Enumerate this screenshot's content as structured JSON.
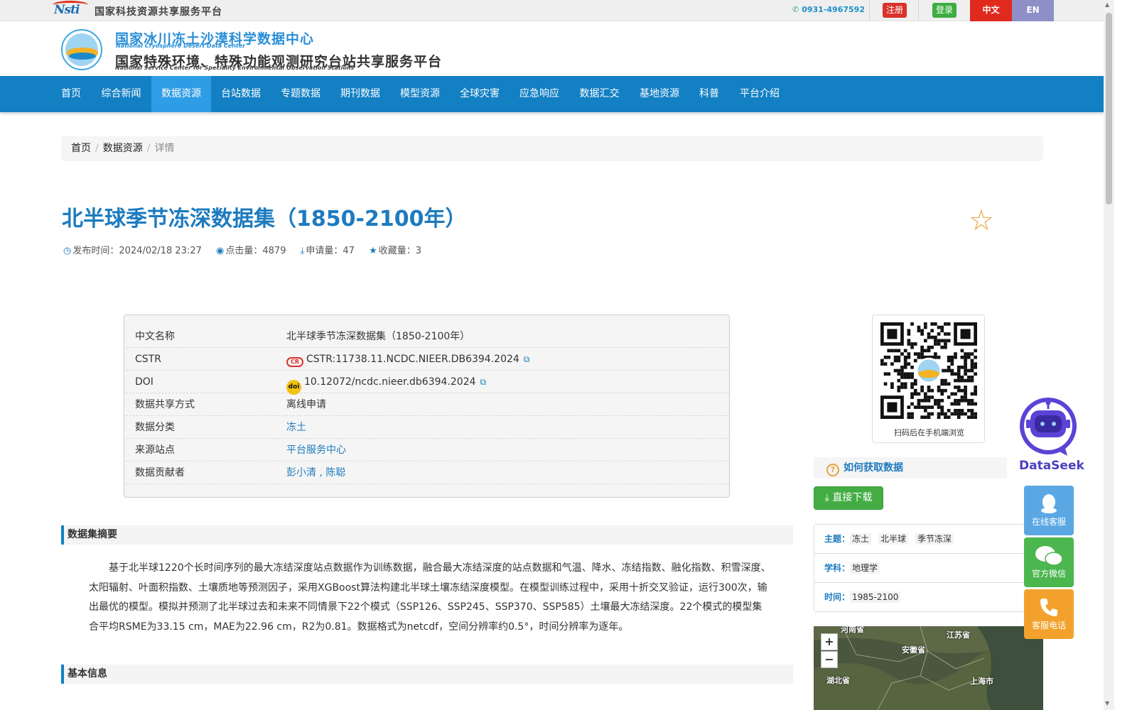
{
  "topbar": {
    "nsti_logo": "Nsti",
    "platform_name": "国家科技资源共享服务平台",
    "phone": "0931-4967592",
    "register_label": "注册",
    "login_label": "登录",
    "lang_zh": "中文",
    "lang_en": "EN"
  },
  "header": {
    "title_cn": "国家冰川冻土沙漠科学数据中心",
    "title_en": "National Cryosphere Desert Data Center",
    "subtitle_cn": "国家特殊环境、特殊功能观测研究台站共享服务平台",
    "subtitle_en": "National Service Center for Speciality Environmental Observation Stations"
  },
  "nav": {
    "items": [
      "首页",
      "综合新闻",
      "数据资源",
      "台站数据",
      "专题数据",
      "期刊数据",
      "模型资源",
      "全球灾害",
      "应急响应",
      "数据汇交",
      "基地资源",
      "科普",
      "平台介绍"
    ],
    "active": "数据资源"
  },
  "breadcrumb": [
    "首页",
    "数据资源",
    "详情"
  ],
  "dataset": {
    "title": "北半球季节冻深数据集（1850-2100年）",
    "publish_label": "发布时间：",
    "publish_time": "2024/02/18 23:27",
    "clicks_label": "点击量：",
    "clicks": "4879",
    "requests_label": "申请量：",
    "requests": "47",
    "favorites_label": "收藏量：",
    "favorites": "3"
  },
  "info": [
    {
      "key": "中文名称",
      "value": "北半球季节冻深数据集（1850-2100年）"
    },
    {
      "key": "CSTR",
      "value": "CSTR:11738.11.NCDC.NIEER.DB6394.2024"
    },
    {
      "key": "DOI",
      "value": "10.12072/ncdc.nieer.db6394.2024"
    },
    {
      "key": "数据共享方式",
      "value": "离线申请"
    },
    {
      "key": "数据分类",
      "value": "冻土"
    },
    {
      "key": "来源站点",
      "value": "平台服务中心"
    },
    {
      "key": "数据贡献者",
      "value": "彭小清 , 陈聪"
    }
  ],
  "qr_caption": "扫码后在手机端浏览",
  "dataseek": "DataSeek",
  "howto_label": "如何获取数据",
  "download_label": "直接下载",
  "keywords": {
    "theme_label": "主题：",
    "themes": [
      "冻土",
      "北半球",
      "季节冻深"
    ],
    "discipline_label": "学科：",
    "disciplines": [
      "地理学"
    ],
    "time_label": "时间：",
    "time": "1985-2100"
  },
  "map": {
    "zoom_in": "+",
    "zoom_out": "−",
    "labels": [
      "河南省",
      "江苏省",
      "安徽省",
      "湖北省",
      "上海市"
    ]
  },
  "side_buttons": {
    "online_service": "在线客服",
    "wechat": "官方微信",
    "phone_service": "客服电话"
  },
  "sections": {
    "abstract_title": "数据集摘要",
    "abstract": "基于北半球1220个长时间序列的最大冻结深度站点数据作为训练数据，融合最大冻结深度的站点数据和气温、降水、冻结指数、融化指数、积雪深度、太阳辐射、叶面积指数、土壤质地等预测因子，采用XGBoost算法构建北半球土壤冻结深度模型。在模型训练过程中，采用十折交叉验证，运行300次，输出最优的模型。模拟并预测了北半球过去和未来不同情景下22个模式（SSP126、SSP245、SSP370、SSP585）土壤最大冻结深度。22个模式的模型集合平均RSME为33.15 cm，MAE为22.96 cm，R2为0.81。数据格式为netcdf，空间分辨率约0.5°，时间分辨率为逐年。",
    "basic_info_title": "基本信息"
  }
}
